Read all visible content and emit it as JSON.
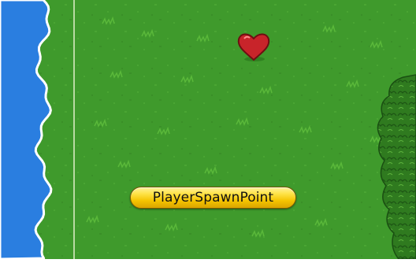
{
  "scene": {
    "spawn_label": "PlayerSpawnPoint",
    "pickup": "heart-pickup"
  },
  "colors": {
    "grass": "#3f9a2c",
    "grass_tuft": "#5ab83a",
    "water": "#2a7ee0",
    "foam": "#ffffff",
    "bush": "#2f7a1f",
    "heart": "#c8242a",
    "label_fill": "#f5c400"
  }
}
